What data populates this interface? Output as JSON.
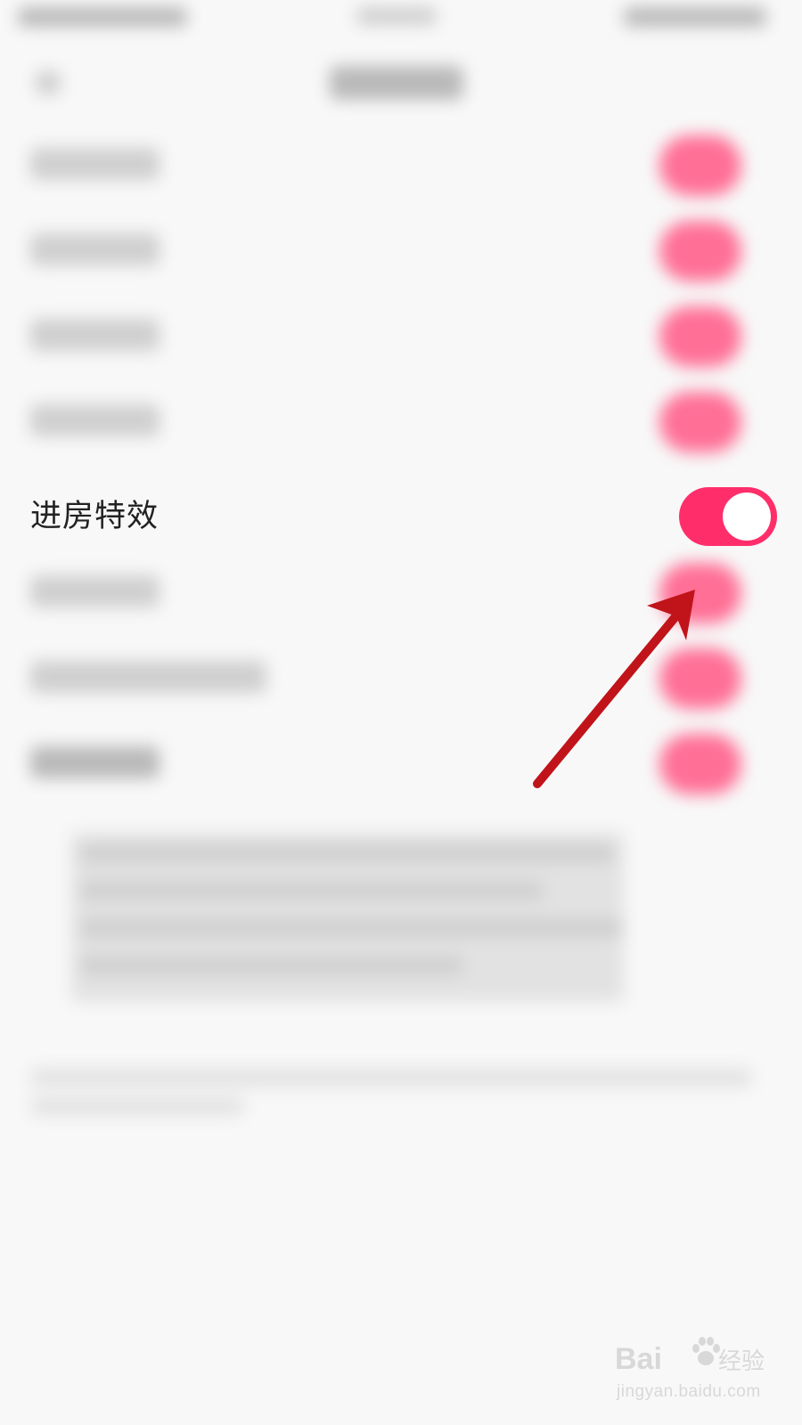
{
  "settings": {
    "active_row": {
      "label": "进房特效",
      "enabled": true
    }
  },
  "colors": {
    "toggle_on": "#ff2e6b",
    "blurred_toggle": "#ff6f96",
    "arrow": "#c0141a"
  },
  "watermark": {
    "brand": "Bai",
    "brand_cn": "经验",
    "url": "jingyan.baidu.com"
  },
  "icons": {
    "annotation": "arrow-icon",
    "watermark_logo": "paw-icon"
  }
}
